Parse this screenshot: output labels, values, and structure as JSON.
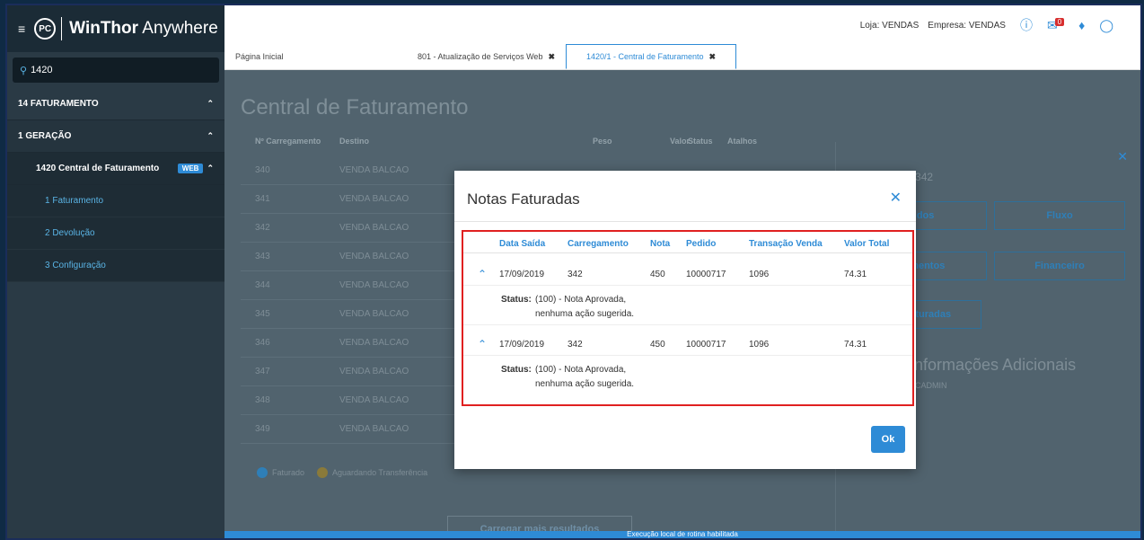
{
  "sidebar": {
    "brand_bold": "WinThor",
    "brand_rest": " Anywhere",
    "search_value": "1420",
    "items": [
      {
        "label": "14  FATURAMENTO"
      },
      {
        "label": "1  GERAÇÃO"
      },
      {
        "label": "1420  Central de Faturamento",
        "badge": "WEB"
      }
    ],
    "subitems": [
      {
        "label": "1  Faturamento"
      },
      {
        "label": "2  Devolução"
      },
      {
        "label": "3  Configuração"
      }
    ]
  },
  "header": {
    "loja": "Loja: VENDAS",
    "empresa": "Empresa: VENDAS",
    "mail_count": "0"
  },
  "tabs": [
    {
      "label": "Página Inicial"
    },
    {
      "label": "801 - Atualização de Serviços Web"
    },
    {
      "label": "1420/1 - Central de Faturamento"
    }
  ],
  "main": {
    "title": "Central de Faturamento",
    "columns": [
      "Nº Carregamento",
      "Destino",
      "Peso",
      "Valor",
      "Status",
      "Atalhos"
    ],
    "rows": [
      {
        "num": "340",
        "dest": "VENDA BALCAO"
      },
      {
        "num": "341",
        "dest": "VENDA BALCAO"
      },
      {
        "num": "342",
        "dest": "VENDA BALCAO"
      },
      {
        "num": "343",
        "dest": "VENDA BALCAO"
      },
      {
        "num": "344",
        "dest": "VENDA BALCAO"
      },
      {
        "num": "345",
        "dest": "VENDA BALCAO"
      },
      {
        "num": "346",
        "dest": "VENDA BALCAO"
      },
      {
        "num": "347",
        "dest": "VENDA BALCAO"
      },
      {
        "num": "348",
        "dest": "VENDA BALCAO"
      },
      {
        "num": "349",
        "dest": "VENDA BALCAO"
      }
    ],
    "legend": [
      {
        "code": "F",
        "label": "Faturado",
        "color": "#3aa4dd"
      },
      {
        "code": "AT",
        "label": "Aguardando Transferência",
        "color": "#b08a3a"
      }
    ],
    "load_more": "Carregar mais resultados",
    "status_bar": "Execução local de rotina habilitada"
  },
  "panel": {
    "title": "Carregamento 342",
    "btn_pedidos": "Pedidos",
    "btn_fluxo": "Fluxo",
    "btn_documentos": "Documentos",
    "btn_financeiro": "Financeiro",
    "btn_faturadas": "Notas Faturadas",
    "info_title": "Informações Adicionais",
    "info_user": "PCADMIN"
  },
  "modal": {
    "title": "Notas Faturadas",
    "columns": [
      "Data Saída",
      "Carregamento",
      "Nota",
      "Pedido",
      "Transação Venda",
      "Valor Total"
    ],
    "rows": [
      {
        "data": "17/09/2019",
        "carregamento": "342",
        "nota": "450",
        "pedido": "10000717",
        "transacao": "1096",
        "valor": "74.31",
        "status_label": "Status:",
        "status_l1": "(100) - Nota Aprovada,",
        "status_l2": "nenhuma ação sugerida."
      },
      {
        "data": "17/09/2019",
        "carregamento": "342",
        "nota": "450",
        "pedido": "10000717",
        "transacao": "1096",
        "valor": "74.31",
        "status_label": "Status:",
        "status_l1": "(100) - Nota Aprovada,",
        "status_l2": "nenhuma ação sugerida."
      }
    ],
    "ok_label": "Ok"
  }
}
